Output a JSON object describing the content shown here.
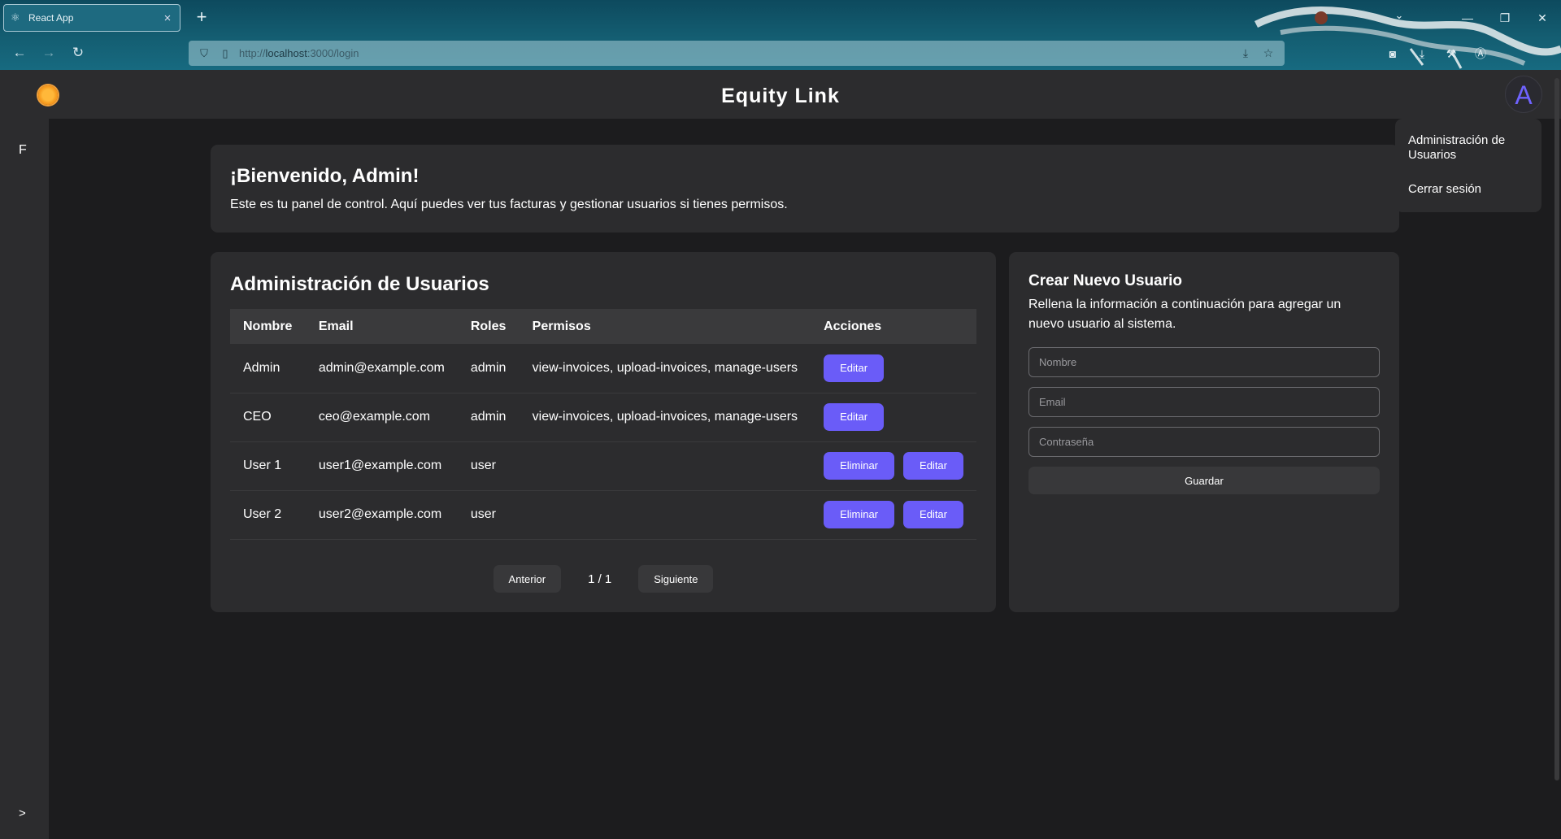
{
  "browser": {
    "tab_title": "React App",
    "url_host": "http://",
    "url_main": "localhost",
    "url_rest": ":3000/login"
  },
  "header": {
    "title": "Equity Link",
    "avatar_letter": "A",
    "logo_icon": "sun-logo"
  },
  "sidebar": {
    "label": "F",
    "toggle": ">"
  },
  "user_menu": {
    "items": [
      "Administración de Usuarios",
      "Cerrar sesión"
    ]
  },
  "welcome": {
    "title": "¡Bienvenido, Admin!",
    "text": "Este es tu panel de control. Aquí puedes ver tus facturas y gestionar usuarios si tienes permisos."
  },
  "users_admin": {
    "title": "Administración de Usuarios",
    "columns": [
      "Nombre",
      "Email",
      "Roles",
      "Permisos",
      "Acciones"
    ],
    "rows": [
      {
        "nombre": "Admin",
        "email": "admin@example.com",
        "roles": "admin",
        "permisos": "view-invoices, upload-invoices, manage-users",
        "actions": [
          "Editar"
        ]
      },
      {
        "nombre": "CEO",
        "email": "ceo@example.com",
        "roles": "admin",
        "permisos": "view-invoices, upload-invoices, manage-users",
        "actions": [
          "Editar"
        ]
      },
      {
        "nombre": "User 1",
        "email": "user1@example.com",
        "roles": "user",
        "permisos": "",
        "actions": [
          "Eliminar",
          "Editar"
        ]
      },
      {
        "nombre": "User 2",
        "email": "user2@example.com",
        "roles": "user",
        "permisos": "",
        "actions": [
          "Eliminar",
          "Editar"
        ]
      }
    ],
    "pager": {
      "prev": "Anterior",
      "indicator": "1 / 1",
      "next": "Siguiente"
    }
  },
  "create_user": {
    "title": "Crear Nuevo Usuario",
    "description": "Rellena la información a continuación para agregar un nuevo usuario al sistema.",
    "fields": {
      "name_placeholder": "Nombre",
      "email_placeholder": "Email",
      "password_placeholder": "Contraseña"
    },
    "save_label": "Guardar"
  },
  "colors": {
    "accent": "#6a5cf8",
    "card_bg": "#2c2c2e",
    "page_bg": "#1c1c1e"
  }
}
